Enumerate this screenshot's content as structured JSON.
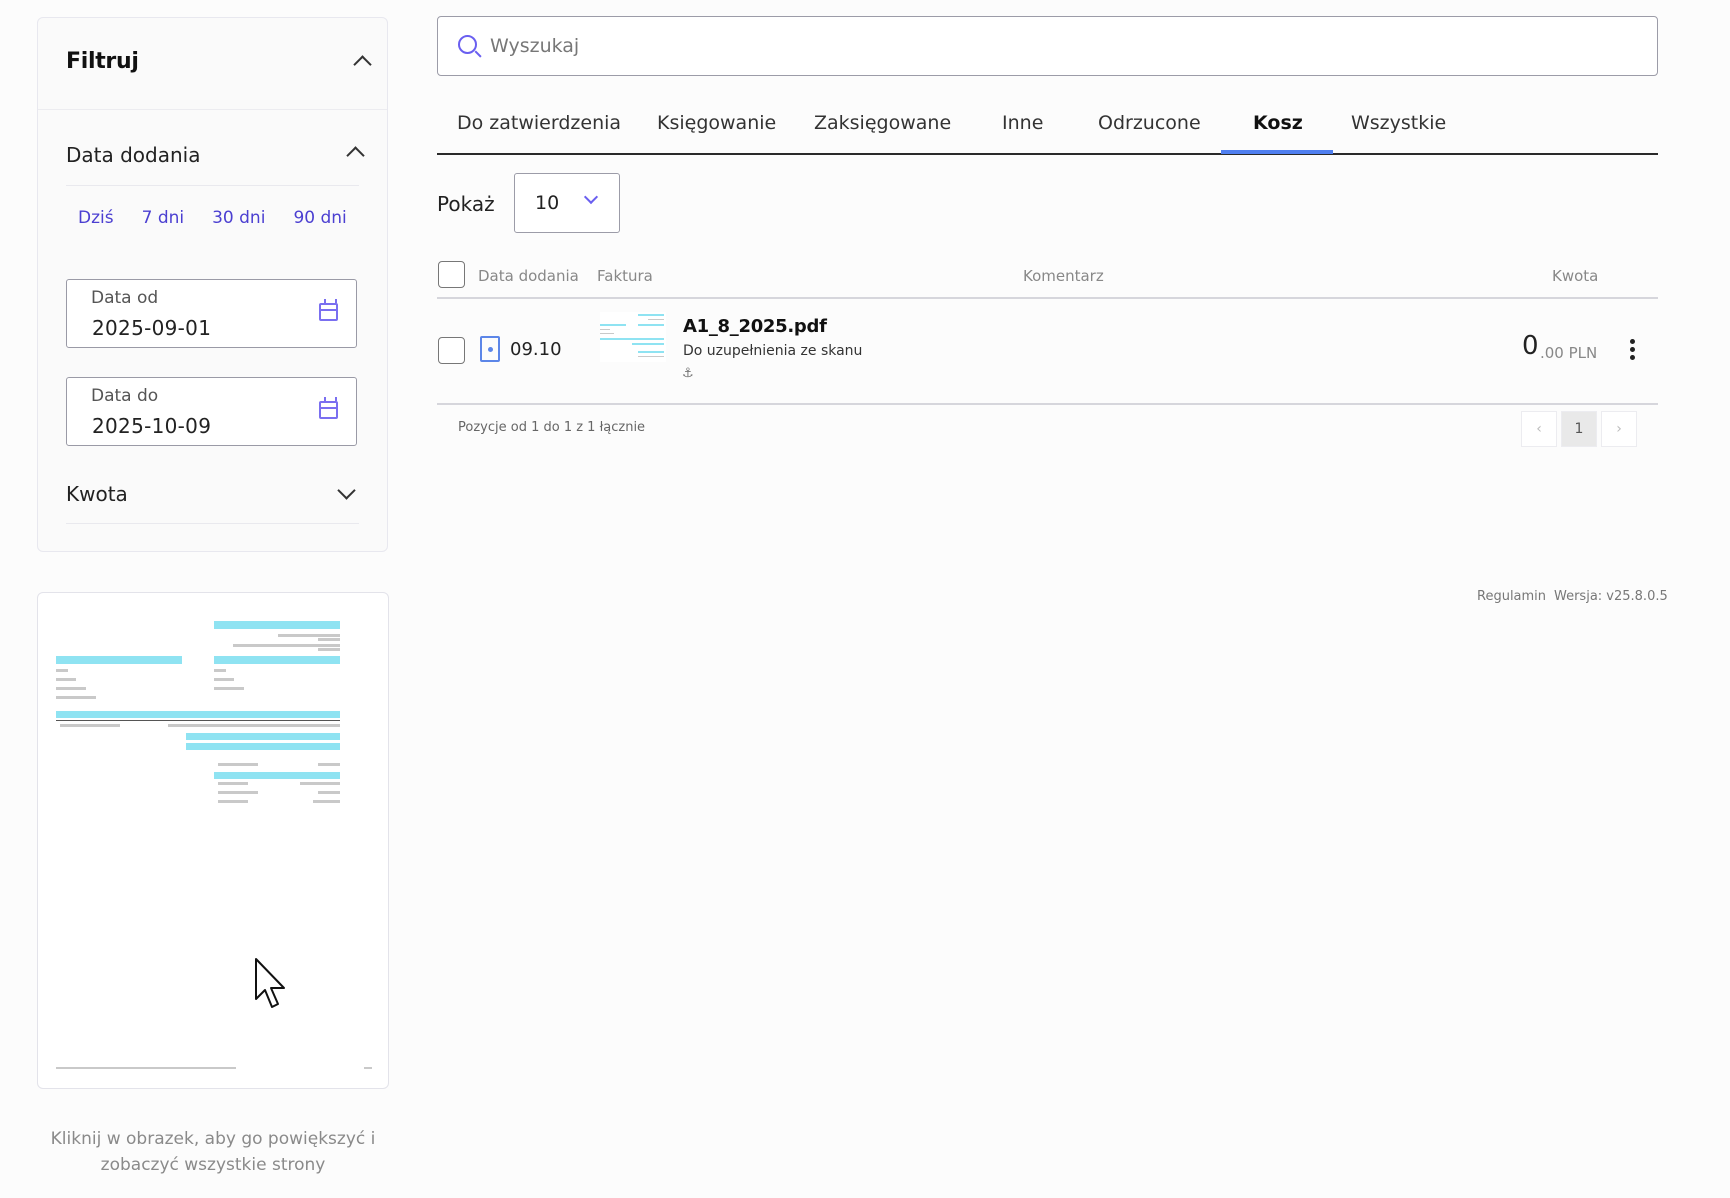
{
  "filter": {
    "title": "Filtruj",
    "date_section": {
      "title": "Data dodania",
      "quick_ranges": [
        "Dziś",
        "7 dni",
        "30 dni",
        "90 dni"
      ],
      "from": {
        "label": "Data od",
        "value": "2025-09-01"
      },
      "to": {
        "label": "Data do",
        "value": "2025-10-09"
      }
    },
    "amount_section": {
      "title": "Kwota"
    }
  },
  "preview": {
    "caption": "Kliknij w obrazek, aby go powiększyć i zobaczyć wszystkie strony"
  },
  "search": {
    "placeholder": "Wyszukaj"
  },
  "tabs": [
    {
      "label": "Do zatwierdzenia",
      "active": false
    },
    {
      "label": "Księgowanie",
      "active": false
    },
    {
      "label": "Zaksięgowane",
      "active": false
    },
    {
      "label": "Inne",
      "active": false
    },
    {
      "label": "Odrzucone",
      "active": false
    },
    {
      "label": "Kosz",
      "active": true
    },
    {
      "label": "Wszystkie",
      "active": false
    }
  ],
  "show": {
    "label": "Pokaż",
    "value": "10"
  },
  "table": {
    "columns": [
      "Data dodania",
      "Faktura",
      "Komentarz",
      "Kwota"
    ],
    "rows": [
      {
        "date": "09.10",
        "file_name": "A1_8_2025.pdf",
        "comment": "Do uzupełnienia ze skanu",
        "anchor": "⚓",
        "amount_int": "0",
        "amount_frac": ".00 PLN"
      }
    ]
  },
  "pagination": {
    "info": "Pozycje od 1 do 1 z 1 łącznie",
    "prev": "‹",
    "current": "1",
    "next": "›"
  },
  "footer": {
    "terms": "Regulamin",
    "version": "Wersja: v25.8.0.5"
  },
  "colors": {
    "accent": "#4b3fd1",
    "tab_underline": "#4f7ff0",
    "doc_icon": "#5c86e8"
  }
}
